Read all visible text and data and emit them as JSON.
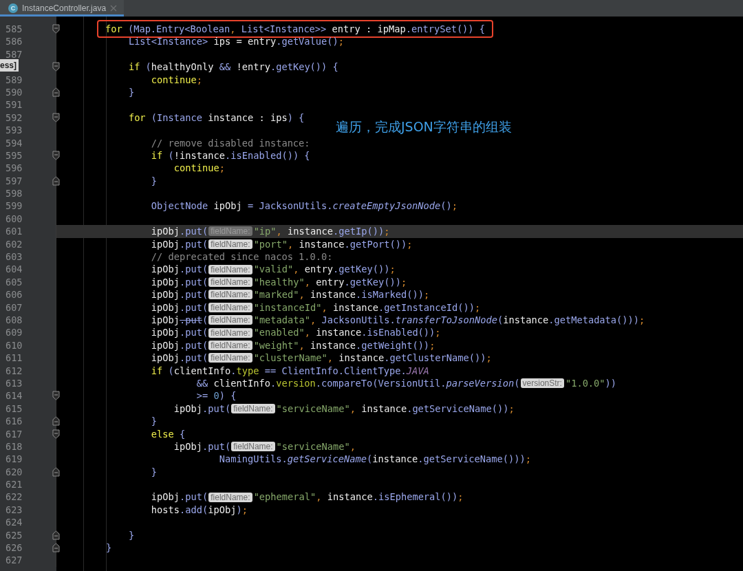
{
  "tab": {
    "icon_text": "C",
    "title": "InstanceController.java",
    "selected": true
  },
  "popup": {
    "text": "ess]"
  },
  "annotation": {
    "text": "遍历，完成JSON字符串的组装"
  },
  "lines": [
    {
      "number": "585",
      "fold": {
        "kind": "start"
      },
      "current": false,
      "boxed": true,
      "tokens": [
        {
          "kind": "kw",
          "text": "        for"
        },
        {
          "kind": "me",
          "text": " (Map.Entry<Boolean"
        },
        {
          "kind": "pu",
          "text": ", "
        },
        {
          "kind": "me",
          "text": "List<Instance>>"
        },
        {
          "kind": "pl",
          "text": " entry : ipMap"
        },
        {
          "kind": "me",
          "text": ".entrySet()) {"
        }
      ]
    },
    {
      "number": "586",
      "current": false,
      "boxed": false,
      "tokens": [
        {
          "kind": "me",
          "text": "            List<Instance>"
        },
        {
          "kind": "pl",
          "text": " ips = entry"
        },
        {
          "kind": "me",
          "text": ".getValue()"
        },
        {
          "kind": "pu",
          "text": ";"
        }
      ]
    },
    {
      "number": "587",
      "current": false,
      "boxed": false
    },
    {
      "current": false,
      "boxed": false,
      "fold": {
        "kind": "start"
      },
      "tokens": [
        {
          "kind": "kw",
          "text": "            if"
        },
        {
          "kind": "me",
          "text": " ("
        },
        {
          "kind": "pl",
          "text": "healthyOnly "
        },
        {
          "kind": "me",
          "text": "&& "
        },
        {
          "kind": "pl",
          "text": "!entry"
        },
        {
          "kind": "me",
          "text": ".getKey()) {"
        }
      ]
    },
    {
      "number": "589",
      "current": false,
      "boxed": false,
      "tokens": [
        {
          "kind": "kw",
          "text": "                continue"
        },
        {
          "kind": "pu",
          "text": ";"
        }
      ]
    },
    {
      "number": "590",
      "fold": {
        "kind": "end"
      },
      "current": false,
      "boxed": false,
      "tokens": [
        {
          "kind": "me",
          "text": "            }"
        }
      ]
    },
    {
      "number": "591",
      "current": false,
      "boxed": false
    },
    {
      "number": "592",
      "fold": {
        "kind": "start"
      },
      "current": false,
      "boxed": false,
      "tokens": [
        {
          "kind": "kw",
          "text": "            for"
        },
        {
          "kind": "me",
          "text": " (Instance"
        },
        {
          "kind": "pl",
          "text": " instance : ips"
        },
        {
          "kind": "me",
          "text": ") {"
        }
      ]
    },
    {
      "number": "593",
      "current": false,
      "boxed": false
    },
    {
      "number": "594",
      "current": false,
      "boxed": false,
      "tokens": [
        {
          "kind": "cm",
          "text": "                // remove disabled instance:"
        }
      ]
    },
    {
      "number": "595",
      "fold": {
        "kind": "start"
      },
      "current": false,
      "boxed": false,
      "tokens": [
        {
          "kind": "kw",
          "text": "                if"
        },
        {
          "kind": "me",
          "text": " ("
        },
        {
          "kind": "pl",
          "text": "!instance"
        },
        {
          "kind": "me",
          "text": ".isEnabled()) {"
        }
      ]
    },
    {
      "number": "596",
      "current": false,
      "boxed": false,
      "tokens": [
        {
          "kind": "kw",
          "text": "                    continue"
        },
        {
          "kind": "pu",
          "text": ";"
        }
      ]
    },
    {
      "number": "597",
      "fold": {
        "kind": "end"
      },
      "current": false,
      "boxed": false,
      "tokens": [
        {
          "kind": "me",
          "text": "                }"
        }
      ]
    },
    {
      "number": "598",
      "current": false,
      "boxed": false
    },
    {
      "number": "599",
      "current": false,
      "boxed": false,
      "tokens": [
        {
          "kind": "me",
          "text": "                ObjectNode"
        },
        {
          "kind": "pl",
          "text": " ipObj "
        },
        {
          "kind": "me",
          "text": "= JacksonUtils."
        },
        {
          "kind": "it",
          "text": "createEmptyJsonNode"
        },
        {
          "kind": "me",
          "text": "()"
        },
        {
          "kind": "pu",
          "text": ";"
        }
      ]
    },
    {
      "number": "600",
      "current": false,
      "boxed": false
    },
    {
      "number": "601",
      "current": true,
      "boxed": false,
      "tokens": [
        {
          "kind": "pl",
          "text": "                ipObj"
        },
        {
          "kind": "me",
          "text": ".put("
        },
        {
          "kind": "hint",
          "text": "fieldName:"
        },
        {
          "kind": "st",
          "text": "\"ip\""
        },
        {
          "kind": "pu",
          "text": ", "
        },
        {
          "kind": "pl",
          "text": "instance"
        },
        {
          "kind": "me",
          "text": ".getIp())"
        },
        {
          "kind": "pu",
          "text": ";"
        }
      ]
    },
    {
      "number": "602",
      "current": false,
      "boxed": false,
      "tokens": [
        {
          "kind": "pl",
          "text": "                ipObj"
        },
        {
          "kind": "me",
          "text": ".put("
        },
        {
          "kind": "hint",
          "text": "fieldName:"
        },
        {
          "kind": "st",
          "text": "\"port\""
        },
        {
          "kind": "pu",
          "text": ", "
        },
        {
          "kind": "pl",
          "text": "instance"
        },
        {
          "kind": "me",
          "text": ".getPort())"
        },
        {
          "kind": "pu",
          "text": ";"
        }
      ]
    },
    {
      "number": "603",
      "current": false,
      "boxed": false,
      "tokens": [
        {
          "kind": "cm",
          "text": "                // deprecated since nacos 1.0.0:"
        }
      ]
    },
    {
      "number": "604",
      "current": false,
      "boxed": false,
      "tokens": [
        {
          "kind": "pl",
          "text": "                ipObj"
        },
        {
          "kind": "me",
          "text": ".put("
        },
        {
          "kind": "hint",
          "text": "fieldName:"
        },
        {
          "kind": "st",
          "text": "\"valid\""
        },
        {
          "kind": "pu",
          "text": ", "
        },
        {
          "kind": "pl",
          "text": "entry"
        },
        {
          "kind": "me",
          "text": ".getKey())"
        },
        {
          "kind": "pu",
          "text": ";"
        }
      ]
    },
    {
      "number": "605",
      "current": false,
      "boxed": false,
      "tokens": [
        {
          "kind": "pl",
          "text": "                ipObj"
        },
        {
          "kind": "me",
          "text": ".put("
        },
        {
          "kind": "hint",
          "text": "fieldName:"
        },
        {
          "kind": "st",
          "text": "\"healthy\""
        },
        {
          "kind": "pu",
          "text": ", "
        },
        {
          "kind": "pl",
          "text": "entry"
        },
        {
          "kind": "me",
          "text": ".getKey())"
        },
        {
          "kind": "pu",
          "text": ";"
        }
      ]
    },
    {
      "number": "606",
      "current": false,
      "boxed": false,
      "tokens": [
        {
          "kind": "pl",
          "text": "                ipObj"
        },
        {
          "kind": "me",
          "text": ".put("
        },
        {
          "kind": "hint",
          "text": "fieldName:"
        },
        {
          "kind": "st",
          "text": "\"marked\""
        },
        {
          "kind": "pu",
          "text": ", "
        },
        {
          "kind": "pl",
          "text": "instance"
        },
        {
          "kind": "me",
          "text": ".isMarked())"
        },
        {
          "kind": "pu",
          "text": ";"
        }
      ]
    },
    {
      "number": "607",
      "current": false,
      "boxed": false,
      "tokens": [
        {
          "kind": "pl",
          "text": "                ipObj"
        },
        {
          "kind": "me",
          "text": ".put("
        },
        {
          "kind": "hint",
          "text": "fieldName:"
        },
        {
          "kind": "st",
          "text": "\"instanceId\""
        },
        {
          "kind": "pu",
          "text": ", "
        },
        {
          "kind": "pl",
          "text": "instance"
        },
        {
          "kind": "me",
          "text": ".getInstanceId())"
        },
        {
          "kind": "pu",
          "text": ";"
        }
      ]
    },
    {
      "number": "608",
      "current": false,
      "boxed": false,
      "tokens": [
        {
          "kind": "pl",
          "text": "                ipObj"
        },
        {
          "kind": "dep",
          "text": ".put"
        },
        {
          "kind": "me",
          "text": "("
        },
        {
          "kind": "hint",
          "text": "fieldName:"
        },
        {
          "kind": "st",
          "text": "\"metadata\""
        },
        {
          "kind": "pu",
          "text": ", "
        },
        {
          "kind": "me",
          "text": "JacksonUtils."
        },
        {
          "kind": "it",
          "text": "transferToJsonNode"
        },
        {
          "kind": "me",
          "text": "("
        },
        {
          "kind": "pl",
          "text": "instance"
        },
        {
          "kind": "me",
          "text": ".getMetadata()))"
        },
        {
          "kind": "pu",
          "text": ";"
        }
      ]
    },
    {
      "number": "609",
      "current": false,
      "boxed": false,
      "tokens": [
        {
          "kind": "pl",
          "text": "                ipObj"
        },
        {
          "kind": "me",
          "text": ".put("
        },
        {
          "kind": "hint",
          "text": "fieldName:"
        },
        {
          "kind": "st",
          "text": "\"enabled\""
        },
        {
          "kind": "pu",
          "text": ", "
        },
        {
          "kind": "pl",
          "text": "instance"
        },
        {
          "kind": "me",
          "text": ".isEnabled())"
        },
        {
          "kind": "pu",
          "text": ";"
        }
      ]
    },
    {
      "number": "610",
      "current": false,
      "boxed": false,
      "tokens": [
        {
          "kind": "pl",
          "text": "                ipObj"
        },
        {
          "kind": "me",
          "text": ".put("
        },
        {
          "kind": "hint",
          "text": "fieldName:"
        },
        {
          "kind": "st",
          "text": "\"weight\""
        },
        {
          "kind": "pu",
          "text": ", "
        },
        {
          "kind": "pl",
          "text": "instance"
        },
        {
          "kind": "me",
          "text": ".getWeight())"
        },
        {
          "kind": "pu",
          "text": ";"
        }
      ]
    },
    {
      "number": "611",
      "current": false,
      "boxed": false,
      "tokens": [
        {
          "kind": "pl",
          "text": "                ipObj"
        },
        {
          "kind": "me",
          "text": ".put("
        },
        {
          "kind": "hint",
          "text": "fieldName:"
        },
        {
          "kind": "st",
          "text": "\"clusterName\""
        },
        {
          "kind": "pu",
          "text": ", "
        },
        {
          "kind": "pl",
          "text": "instance"
        },
        {
          "kind": "me",
          "text": ".getClusterName())"
        },
        {
          "kind": "pu",
          "text": ";"
        }
      ]
    },
    {
      "number": "612",
      "current": false,
      "boxed": false,
      "tokens": [
        {
          "kind": "kw",
          "text": "                if"
        },
        {
          "kind": "me",
          "text": " ("
        },
        {
          "kind": "pl",
          "text": "clientInfo"
        },
        {
          "kind": "me",
          "text": "."
        },
        {
          "kind": "fd",
          "text": "type"
        },
        {
          "kind": "me",
          "text": " == ClientInfo.ClientType."
        },
        {
          "kind": "cs",
          "text": "JAVA"
        }
      ]
    },
    {
      "number": "613",
      "current": false,
      "boxed": false,
      "tokens": [
        {
          "kind": "me",
          "text": "                        && "
        },
        {
          "kind": "pl",
          "text": "clientInfo"
        },
        {
          "kind": "me",
          "text": "."
        },
        {
          "kind": "fd",
          "text": "version"
        },
        {
          "kind": "me",
          "text": ".compareTo(VersionUtil."
        },
        {
          "kind": "it",
          "text": "parseVersion"
        },
        {
          "kind": "me",
          "text": "("
        },
        {
          "kind": "hint",
          "text": "versionStr:"
        },
        {
          "kind": "st",
          "text": "\"1.0.0\""
        },
        {
          "kind": "me",
          "text": "))"
        }
      ]
    },
    {
      "number": "614",
      "fold": {
        "kind": "start"
      },
      "current": false,
      "boxed": false,
      "tokens": [
        {
          "kind": "me",
          "text": "                        >= "
        },
        {
          "kind": "nu",
          "text": "0"
        },
        {
          "kind": "me",
          "text": ") {"
        }
      ]
    },
    {
      "number": "615",
      "current": false,
      "boxed": false,
      "tokens": [
        {
          "kind": "pl",
          "text": "                    ipObj"
        },
        {
          "kind": "me",
          "text": ".put("
        },
        {
          "kind": "hint",
          "text": "fieldName:"
        },
        {
          "kind": "st",
          "text": "\"serviceName\""
        },
        {
          "kind": "pu",
          "text": ", "
        },
        {
          "kind": "pl",
          "text": "instance"
        },
        {
          "kind": "me",
          "text": ".getServiceName())"
        },
        {
          "kind": "pu",
          "text": ";"
        }
      ]
    },
    {
      "number": "616",
      "fold": {
        "kind": "end"
      },
      "current": false,
      "boxed": false,
      "tokens": [
        {
          "kind": "me",
          "text": "                }"
        }
      ]
    },
    {
      "number": "617",
      "fold": {
        "kind": "start"
      },
      "current": false,
      "boxed": false,
      "tokens": [
        {
          "kind": "kw",
          "text": "                else"
        },
        {
          "kind": "me",
          "text": " {"
        }
      ]
    },
    {
      "number": "618",
      "current": false,
      "boxed": false,
      "tokens": [
        {
          "kind": "pl",
          "text": "                    ipObj"
        },
        {
          "kind": "me",
          "text": ".put("
        },
        {
          "kind": "hint",
          "text": "fieldName:"
        },
        {
          "kind": "st",
          "text": "\"serviceName\""
        },
        {
          "kind": "pu",
          "text": ","
        }
      ]
    },
    {
      "number": "619",
      "current": false,
      "boxed": false,
      "tokens": [
        {
          "kind": "me",
          "text": "                            NamingUtils."
        },
        {
          "kind": "it",
          "text": "getServiceName"
        },
        {
          "kind": "me",
          "text": "("
        },
        {
          "kind": "pl",
          "text": "instance"
        },
        {
          "kind": "me",
          "text": ".getServiceName()))"
        },
        {
          "kind": "pu",
          "text": ";"
        }
      ]
    },
    {
      "number": "620",
      "fold": {
        "kind": "end"
      },
      "current": false,
      "boxed": false,
      "tokens": [
        {
          "kind": "me",
          "text": "                }"
        }
      ]
    },
    {
      "number": "621",
      "current": false,
      "boxed": false
    },
    {
      "number": "622",
      "current": false,
      "boxed": false,
      "tokens": [
        {
          "kind": "pl",
          "text": "                ipObj"
        },
        {
          "kind": "me",
          "text": ".put("
        },
        {
          "kind": "hint",
          "text": "fieldName:"
        },
        {
          "kind": "st",
          "text": "\"ephemeral\""
        },
        {
          "kind": "pu",
          "text": ", "
        },
        {
          "kind": "pl",
          "text": "instance"
        },
        {
          "kind": "me",
          "text": ".isEphemeral())"
        },
        {
          "kind": "pu",
          "text": ";"
        }
      ]
    },
    {
      "number": "623",
      "current": false,
      "boxed": false,
      "tokens": [
        {
          "kind": "pl",
          "text": "                hosts"
        },
        {
          "kind": "me",
          "text": ".add("
        },
        {
          "kind": "pl",
          "text": "ipObj"
        },
        {
          "kind": "me",
          "text": ")"
        },
        {
          "kind": "pu",
          "text": ";"
        }
      ]
    },
    {
      "number": "624",
      "current": false,
      "boxed": false
    },
    {
      "number": "625",
      "fold": {
        "kind": "end"
      },
      "current": false,
      "boxed": false,
      "tokens": [
        {
          "kind": "me",
          "text": "            }"
        }
      ]
    },
    {
      "number": "626",
      "fold": {
        "kind": "end"
      },
      "current": false,
      "boxed": false,
      "tokens": [
        {
          "kind": "me",
          "text": "        }"
        }
      ]
    },
    {
      "number": "627",
      "current": false,
      "boxed": false
    }
  ]
}
